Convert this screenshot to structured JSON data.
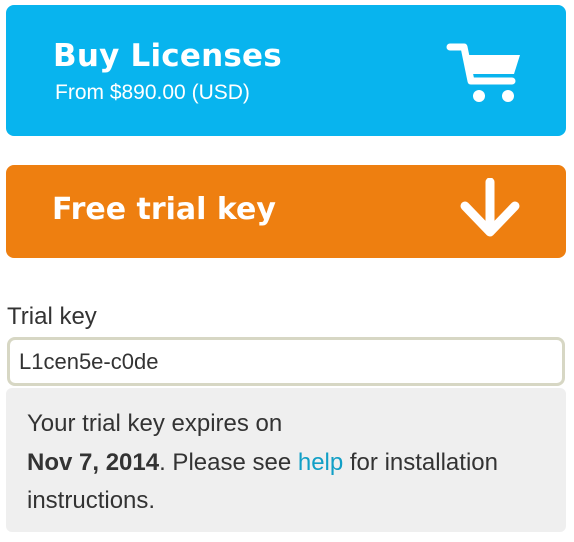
{
  "buy": {
    "title": "Buy Licenses",
    "price": "From $890.00 (USD)",
    "icon": "cart-icon",
    "color": "#08b4ee"
  },
  "trial": {
    "title": "Free trial key",
    "icon": "download-arrow-icon",
    "color": "#ee7f10"
  },
  "field": {
    "label": "Trial key",
    "value": "L1cen5e-c0de"
  },
  "notice": {
    "line_prefix": "Your trial key expires on",
    "date": "Nov 7, 2014",
    "mid": ". Please see ",
    "link": "help",
    "suffix": " for installation instructions.",
    "link_color": "#119fc6"
  }
}
